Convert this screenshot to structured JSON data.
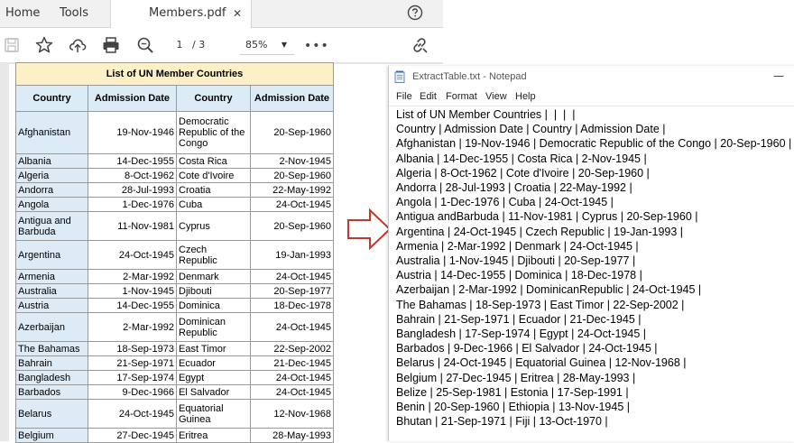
{
  "pdf_viewer": {
    "tabs": {
      "home": "Home",
      "tools": "Tools",
      "document": "Members.pdf",
      "close": "✕"
    },
    "help_icon": "question-circle-icon",
    "toolbar": {
      "icons": [
        "save-icon",
        "star-icon",
        "upload-icon",
        "print-icon",
        "zoom-search-icon",
        "link-icon"
      ],
      "page_current": "1",
      "page_total": "/ 3",
      "zoom": "85%",
      "more": "•••"
    },
    "table": {
      "title": "List of UN Member Countries",
      "headers": [
        "Country",
        "Admission Date",
        "Country",
        "Admission Date"
      ],
      "rows": [
        {
          "c1": "Afghanistan",
          "d1": "19-Nov-1946",
          "c2": "Democratic Republic of the Congo",
          "d2": "20-Sep-1960",
          "h": "h3"
        },
        {
          "c1": "Albania",
          "d1": "14-Dec-1955",
          "c2": "Costa Rica",
          "d2": "2-Nov-1945",
          "h": "h1"
        },
        {
          "c1": "Algeria",
          "d1": "8-Oct-1962",
          "c2": "Cote d'Ivoire",
          "d2": "20-Sep-1960",
          "h": "h1"
        },
        {
          "c1": "Andorra",
          "d1": "28-Jul-1993",
          "c2": "Croatia",
          "d2": "22-May-1992",
          "h": "h1"
        },
        {
          "c1": "Angola",
          "d1": "1-Dec-1976",
          "c2": "Cuba",
          "d2": "24-Oct-1945",
          "h": "h1"
        },
        {
          "c1": "Antigua and Barbuda",
          "d1": "11-Nov-1981",
          "c2": "Cyprus",
          "d2": "20-Sep-1960",
          "h": "h2"
        },
        {
          "c1": "Argentina",
          "d1": "24-Oct-1945",
          "c2": "Czech Republic",
          "d2": "19-Jan-1993",
          "h": "h2"
        },
        {
          "c1": "Armenia",
          "d1": "2-Mar-1992",
          "c2": "Denmark",
          "d2": "24-Oct-1945",
          "h": "h1"
        },
        {
          "c1": "Australia",
          "d1": "1-Nov-1945",
          "c2": "Djibouti",
          "d2": "20-Sep-1977",
          "h": "h1"
        },
        {
          "c1": "Austria",
          "d1": "14-Dec-1955",
          "c2": "Dominica",
          "d2": "18-Dec-1978",
          "h": "h1"
        },
        {
          "c1": "Azerbaijan",
          "d1": "2-Mar-1992",
          "c2": "Dominican Republic",
          "d2": "24-Oct-1945",
          "h": "h2"
        },
        {
          "c1": "The Bahamas",
          "d1": "18-Sep-1973",
          "c2": "East Timor",
          "d2": "22-Sep-2002",
          "h": "h1"
        },
        {
          "c1": "Bahrain",
          "d1": "21-Sep-1971",
          "c2": "Ecuador",
          "d2": "21-Dec-1945",
          "h": "h1"
        },
        {
          "c1": "Bangladesh",
          "d1": "17-Sep-1974",
          "c2": "Egypt",
          "d2": "24-Oct-1945",
          "h": "h1"
        },
        {
          "c1": "Barbados",
          "d1": "9-Dec-1966",
          "c2": "El Salvador",
          "d2": "24-Oct-1945",
          "h": "h1"
        },
        {
          "c1": "Belarus",
          "d1": "24-Oct-1945",
          "c2": "Equatorial Guinea",
          "d2": "12-Nov-1968",
          "h": "h2"
        },
        {
          "c1": "Belgium",
          "d1": "27-Dec-1945",
          "c2": "Eritrea",
          "d2": "28-May-1993",
          "h": "h1"
        }
      ]
    }
  },
  "arrow_icon": "right-arrow-icon",
  "notepad": {
    "title": "ExtractTable.txt - Notepad",
    "minimize": "—",
    "menu": [
      "File",
      "Edit",
      "Format",
      "View",
      "Help"
    ],
    "lines": [
      "List of UN Member Countries |  |  |  |",
      "Country | Admission Date | Country | Admission Date |",
      "Afghanistan | 19-Nov-1946 | Democratic Republic of the Congo | 20-Sep-1960 |",
      "Albania | 14-Dec-1955 | Costa Rica | 2-Nov-1945 |",
      "Algeria | 8-Oct-1962 | Cote d'Ivoire | 20-Sep-1960 |",
      "Andorra | 28-Jul-1993 | Croatia | 22-May-1992 |",
      "Angola | 1-Dec-1976 | Cuba | 24-Oct-1945 |",
      "Antigua andBarbuda | 11-Nov-1981 | Cyprus | 20-Sep-1960 |",
      "Argentina | 24-Oct-1945 | Czech Republic | 19-Jan-1993 |",
      "Armenia | 2-Mar-1992 | Denmark | 24-Oct-1945 |",
      "Australia | 1-Nov-1945 | Djibouti | 20-Sep-1977 |",
      "Austria | 14-Dec-1955 | Dominica | 18-Dec-1978 |",
      "Azerbaijan | 2-Mar-1992 | DominicanRepublic | 24-Oct-1945 |",
      "The Bahamas | 18-Sep-1973 | East Timor | 22-Sep-2002 |",
      "Bahrain | 21-Sep-1971 | Ecuador | 21-Dec-1945 |",
      "Bangladesh | 17-Sep-1974 | Egypt | 24-Oct-1945 |",
      "Barbados | 9-Dec-1966 | El Salvador | 24-Oct-1945 |",
      "Belarus | 24-Oct-1945 | Equatorial Guinea | 12-Nov-1968 |",
      "Belgium | 27-Dec-1945 | Eritrea | 28-May-1993 |",
      "Belize | 25-Sep-1981 | Estonia | 17-Sep-1991 |",
      "Benin | 20-Sep-1960 | Ethiopia | 13-Nov-1945 |",
      "Bhutan | 21-Sep-1971 | Fiji | 13-Oct-1970 |"
    ]
  }
}
